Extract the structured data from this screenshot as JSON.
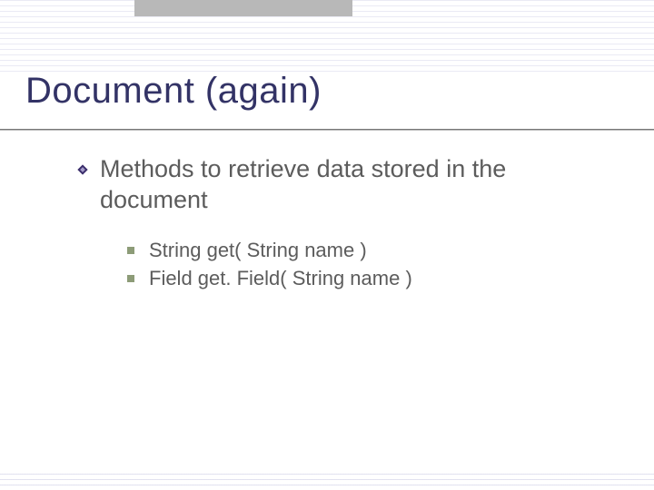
{
  "slide": {
    "title": "Document (again)",
    "bullet1": {
      "text": "Methods to retrieve data stored in the document",
      "children": [
        "String get( String name )",
        "Field get. Field( String name )"
      ]
    }
  }
}
